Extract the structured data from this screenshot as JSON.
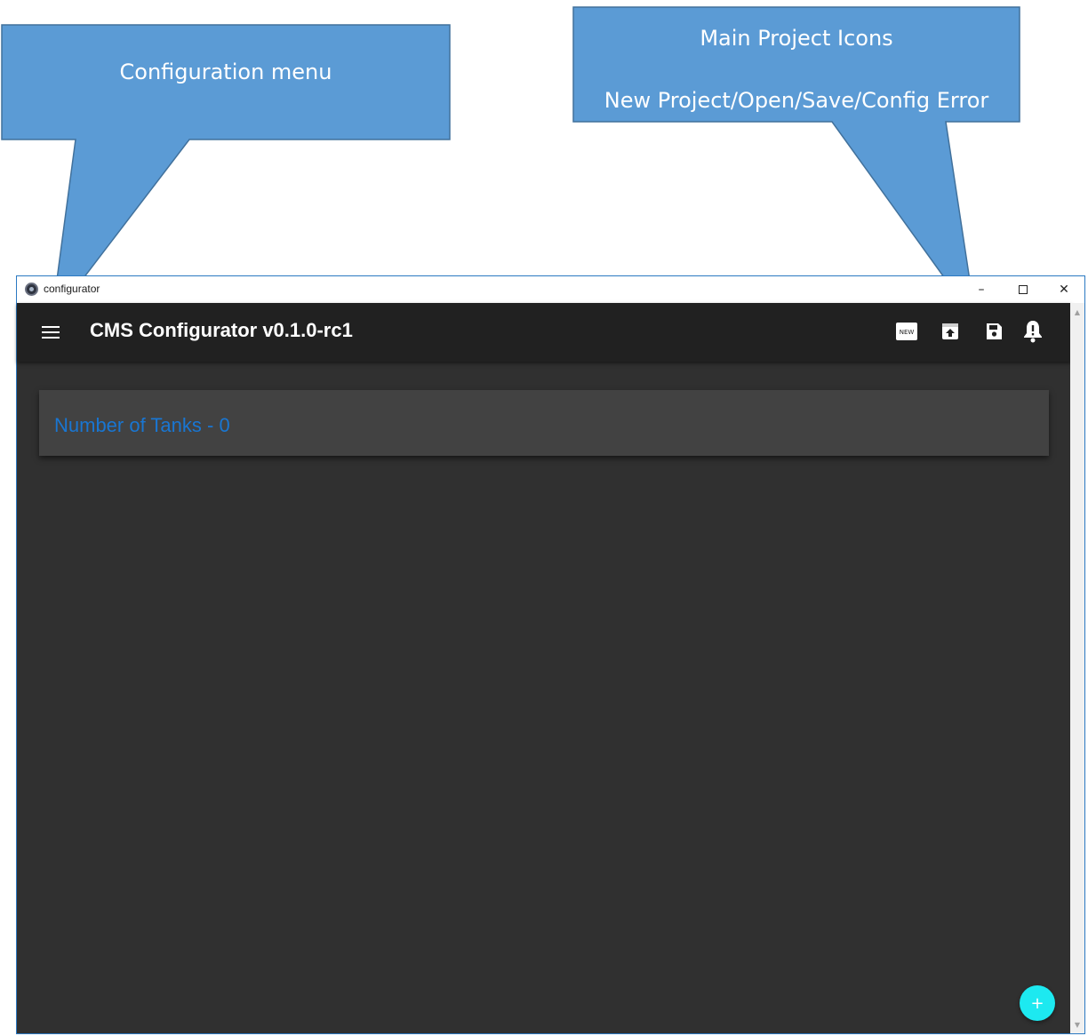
{
  "callouts": {
    "config_menu": "Configuration menu",
    "project_icons_title": "Main Project Icons",
    "project_icons_subtitle": "New Project/Open/Save/Config Error"
  },
  "window": {
    "title": "configurator",
    "minimize": "–",
    "close": "✕"
  },
  "appbar": {
    "title": "CMS Configurator v0.1.0-rc1",
    "new_badge": "NEW",
    "icons": [
      "menu-icon",
      "new-project-icon",
      "open-icon",
      "save-icon",
      "config-error-icon"
    ]
  },
  "main": {
    "card_title": "Number of Tanks - 0",
    "fab_label": "+"
  },
  "colors": {
    "appbar": "#212121",
    "background": "#303030",
    "card": "#424242",
    "accent_text": "#1976d2",
    "fab": "#1de9f0",
    "callout": "#5b9bd5"
  }
}
